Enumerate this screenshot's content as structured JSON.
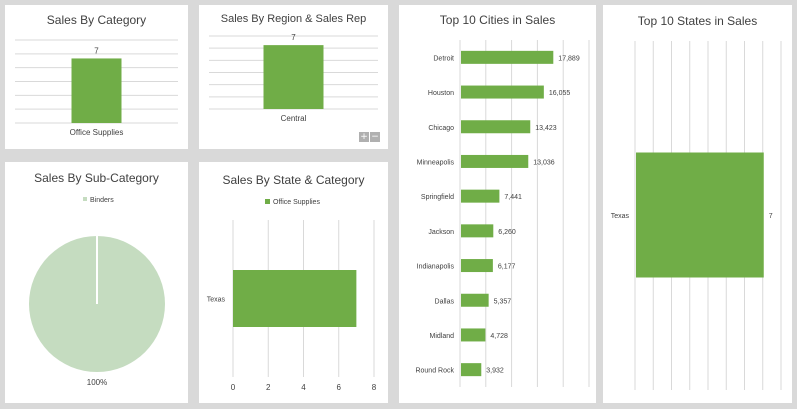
{
  "colors": {
    "bar": "#70ad47",
    "pie": "#c5dcc0",
    "grid": "#d9d9d9",
    "text": "#404040",
    "background": "#d9d9d9"
  },
  "controls": {
    "expand_label": "+",
    "collapse_label": "−"
  },
  "chart_data": [
    {
      "id": "category",
      "type": "bar",
      "title": "Sales By Category",
      "categories": [
        "Office Supplies"
      ],
      "values": [
        7
      ],
      "data_labels": [
        "7"
      ],
      "ylim": [
        0,
        9
      ],
      "grid": true
    },
    {
      "id": "region",
      "type": "bar",
      "title": "Sales By Region & Sales Rep",
      "categories": [
        "Central"
      ],
      "values": [
        7
      ],
      "data_labels": [
        "7"
      ],
      "ylim": [
        0,
        8
      ],
      "grid": true
    },
    {
      "id": "subcategory",
      "type": "pie",
      "title": "Sales By Sub-Category",
      "legend": [
        "Binders"
      ],
      "legend_position": "top",
      "values": [
        100
      ],
      "data_labels": [
        "100%"
      ]
    },
    {
      "id": "state_category",
      "type": "bar",
      "orientation": "horizontal",
      "title": "Sales By State & Category",
      "categories": [
        "Texas"
      ],
      "series": [
        {
          "name": "Office Supplies",
          "values": [
            7
          ]
        }
      ],
      "legend_position": "top",
      "xlim": [
        0,
        8
      ],
      "xticks": [
        "0",
        "2",
        "4",
        "6",
        "8"
      ],
      "grid": true
    },
    {
      "id": "cities",
      "type": "bar",
      "orientation": "horizontal",
      "title": "Top 10 Cities in Sales",
      "categories": [
        "Detroit",
        "Houston",
        "Chicago",
        "Minneapolis",
        "Springfield",
        "Jackson",
        "Indianapolis",
        "Dallas",
        "Midland",
        "Round Rock"
      ],
      "values": [
        17889,
        16055,
        13423,
        13036,
        7441,
        6260,
        6177,
        5357,
        4728,
        3932
      ],
      "data_labels": [
        "17,889",
        "16,055",
        "13,423",
        "13,036",
        "7,441",
        "6,260",
        "6,177",
        "5,357",
        "4,728",
        "3,932"
      ],
      "xlim": [
        0,
        25000
      ],
      "grid": true
    },
    {
      "id": "states",
      "type": "bar",
      "orientation": "horizontal",
      "title": "Top 10 States in Sales",
      "categories": [
        "Texas"
      ],
      "values": [
        7
      ],
      "data_labels": [
        "7"
      ],
      "xlim": [
        0,
        8
      ],
      "grid": true
    }
  ]
}
